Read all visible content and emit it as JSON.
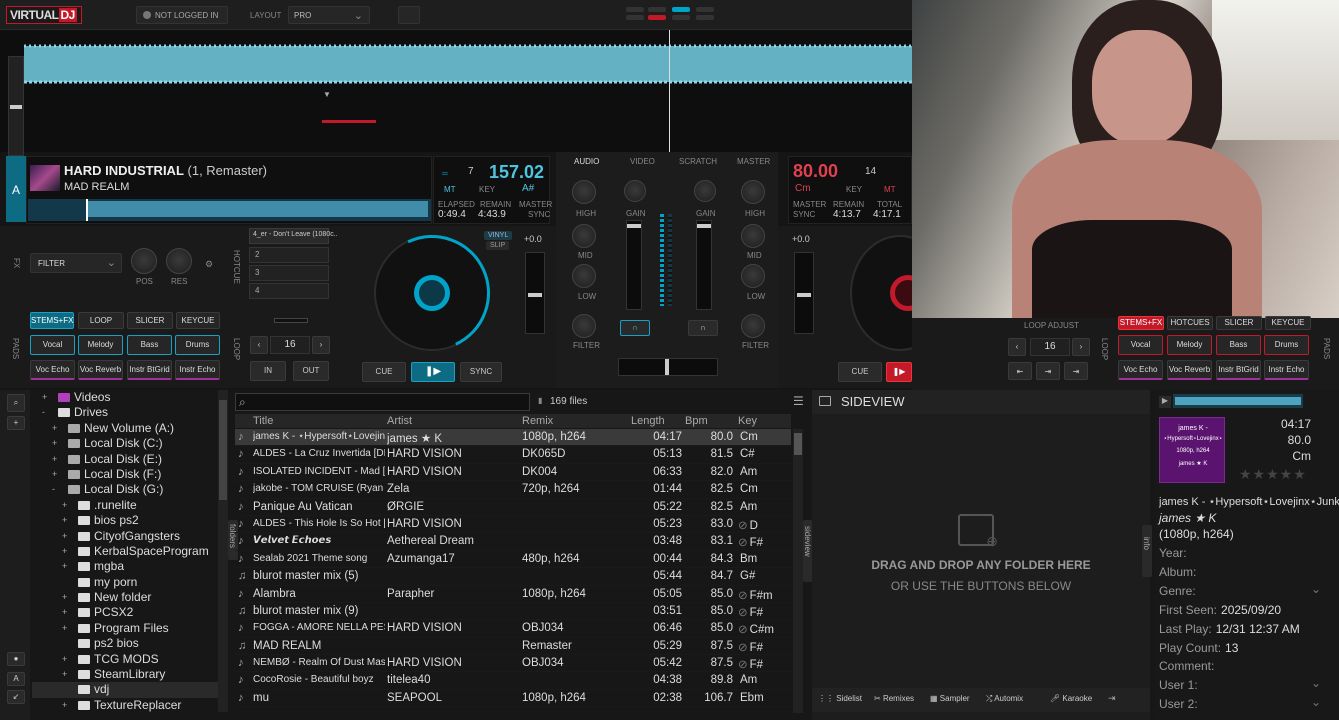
{
  "app": {
    "logo": "VIRTUAL",
    "logo_b": "DJ",
    "login": "NOT LOGGED IN",
    "layout_label": "LAYOUT",
    "layout_value": "PRO"
  },
  "deck_left": {
    "letter": "A",
    "title": "HARD INDUSTRIAL",
    "title_extra": "(1, Remaster)",
    "artist": "MAD REALM",
    "num": "7",
    "bpm": "157.02",
    "mt": "MT",
    "key_label": "KEY",
    "key": "A#",
    "elapsed_label": "ELAPSED",
    "elapsed": "0:49.4",
    "remain_label": "REMAIN",
    "remain": "4:43.9",
    "master": "MASTER",
    "sync": "SYNC",
    "fx_label": "FX",
    "filter": "FILTER",
    "pos": "POS",
    "res": "RES",
    "hotcue_label": "HOTCUE",
    "hotcues": [
      "4_er - Don't Leave (1080c..",
      "2",
      "3",
      "4"
    ],
    "vinyl": "VINYL",
    "slip": "SLIP",
    "pitch": "+0.0",
    "loop_value": "16",
    "in": "IN",
    "out": "OUT",
    "cue": "CUE",
    "sync_btn": "SYNC",
    "pad_tabs": [
      "STEMS+FX",
      "LOOP",
      "SLICER",
      "KEYCUE"
    ],
    "pads": [
      "Vocal",
      "Melody",
      "Bass",
      "Drums",
      "Voc Echo",
      "Voc Reverb",
      "Instr BtGrid",
      "Instr Echo"
    ],
    "pads_label": "PADS",
    "loop_label": "LOOP"
  },
  "mixer": {
    "tabs": [
      "AUDIO",
      "VIDEO",
      "SCRATCH",
      "MASTER"
    ],
    "high": "HIGH",
    "mid": "MID",
    "low": "LOW",
    "gain": "GAIN",
    "filter": "FILTER"
  },
  "deck_right": {
    "bpm": "80.00",
    "num": "14",
    "cm": "Cm",
    "mt": "MT",
    "key_label": "KEY",
    "master": "MASTER",
    "sync": "SYNC",
    "remain_label": "REMAIN",
    "remain": "4:13.7",
    "total_label": "TOTAL",
    "total": "4:17.1",
    "pitch": "+0.0",
    "loop_adjust": "LOOP ADJUST",
    "loop_value": "16",
    "cue": "CUE",
    "sync_btn": "SYNC",
    "pad_tabs": [
      "STEMS+FX",
      "HOTCUES",
      "SLICER",
      "KEYCUE"
    ],
    "pads": [
      "Vocal",
      "Melody",
      "Bass",
      "Drums",
      "Voc Echo",
      "Voc Reverb",
      "Instr BtGrid",
      "Instr Echo"
    ],
    "pads_label": "PADS",
    "loop_label": "LOOP"
  },
  "browser": {
    "file_count": "169 files",
    "folders_tab": "folders",
    "sideview_tab": "sideview",
    "info_tab": "info",
    "tree": [
      {
        "label": "Videos",
        "pm": "+",
        "indent": 0,
        "type": "video"
      },
      {
        "label": "Drives",
        "pm": "-",
        "indent": 0,
        "type": "drive"
      },
      {
        "label": "New Volume (A:)",
        "pm": "+",
        "indent": 1,
        "type": "disk"
      },
      {
        "label": "Local Disk (C:)",
        "pm": "+",
        "indent": 1,
        "type": "disk"
      },
      {
        "label": "Local Disk (E:)",
        "pm": "+",
        "indent": 1,
        "type": "disk"
      },
      {
        "label": "Local Disk (F:)",
        "pm": "+",
        "indent": 1,
        "type": "disk"
      },
      {
        "label": "Local Disk (G:)",
        "pm": "-",
        "indent": 1,
        "type": "disk"
      },
      {
        "label": ".runelite",
        "pm": "+",
        "indent": 2,
        "type": "folder"
      },
      {
        "label": "bios ps2",
        "pm": "+",
        "indent": 2,
        "type": "folder"
      },
      {
        "label": "CityofGangsters",
        "pm": "+",
        "indent": 2,
        "type": "folder"
      },
      {
        "label": "KerbalSpaceProgram",
        "pm": "+",
        "indent": 2,
        "type": "folder"
      },
      {
        "label": "mgba",
        "pm": "+",
        "indent": 2,
        "type": "folder"
      },
      {
        "label": "my porn",
        "pm": "",
        "indent": 2,
        "type": "folder"
      },
      {
        "label": "New folder",
        "pm": "+",
        "indent": 2,
        "type": "folder"
      },
      {
        "label": "PCSX2",
        "pm": "+",
        "indent": 2,
        "type": "folder"
      },
      {
        "label": "Program Files",
        "pm": "+",
        "indent": 2,
        "type": "folder"
      },
      {
        "label": "ps2 bios",
        "pm": "",
        "indent": 2,
        "type": "folder"
      },
      {
        "label": "TCG MODS",
        "pm": "+",
        "indent": 2,
        "type": "folder"
      },
      {
        "label": "SteamLibrary",
        "pm": "+",
        "indent": 2,
        "type": "folder"
      },
      {
        "label": "vdj",
        "pm": "",
        "indent": 2,
        "type": "folder"
      },
      {
        "label": "TextureReplacer",
        "pm": "+",
        "indent": 2,
        "type": "folder"
      }
    ],
    "columns": [
      "Title",
      "Artist",
      "Remix",
      "Length",
      "Bpm",
      "Key"
    ],
    "rows": [
      [
        "james K - ⋆Hypersoft⋆Lovejinx⋆Junkd",
        "james ★ K",
        "1080p, h264",
        "04:17",
        "80.0",
        "Cm",
        ""
      ],
      [
        "ALDES - La Cruz Invertida [DK065D]",
        "HARD VISION",
        "DK065D",
        "05:13",
        "81.5",
        "C#",
        ""
      ],
      [
        "ISOLATED INCIDENT - Mad [DK004]",
        "HARD VISION",
        "DK004",
        "06:33",
        "82.0",
        "Am",
        ""
      ],
      [
        "jakobe - TOM CRUISE (Ryan Celsius)",
        "Zela",
        "720p, h264",
        "01:44",
        "82.5",
        "Cm",
        ""
      ],
      [
        "Panique Au Vatican",
        "ØRGIE",
        "",
        "05:22",
        "82.5",
        "Am",
        ""
      ],
      [
        "ALDES - This Hole Is So Hot [DK065]",
        "HARD VISION",
        "",
        "05:23",
        "83.0",
        "D",
        "⊘"
      ],
      [
        "𝙑𝙚𝙡𝙫𝙚𝙩 𝙀𝙘𝙝𝙤𝙚𝙨",
        "Aethereal Dream",
        "",
        "03:48",
        "83.1",
        "F#",
        "⊘"
      ],
      [
        "Sealab 2021 Theme song",
        "Azumanga17",
        "480p, h264",
        "00:44",
        "84.3",
        "Bm",
        ""
      ],
      [
        "blurot master mix (5)",
        "",
        "",
        "05:44",
        "84.7",
        "G#",
        ""
      ],
      [
        "Alambra",
        "Parapher",
        "1080p, h264",
        "05:05",
        "85.0",
        "F#m",
        "⊘"
      ],
      [
        "blurot master mix (9)",
        "",
        "",
        "03:51",
        "85.0",
        "F#",
        "⊘"
      ],
      [
        "FOGGA - AMORE NELLA PESTE [OBJ034]",
        "HARD VISION",
        "OBJ034",
        "06:46",
        "85.0",
        "C#m",
        "⊘"
      ],
      [
        "MAD REALM",
        "",
        "Remaster",
        "05:29",
        "87.5",
        "F#",
        "⊘"
      ],
      [
        "NEMBØ - Realm Of Dust Master [OBJ034]",
        "HARD VISION",
        "OBJ034",
        "05:42",
        "87.5",
        "F#",
        "⊘"
      ],
      [
        "CocoRosie - Beautiful boyz",
        "titelea40",
        "",
        "04:38",
        "89.8",
        "Am",
        ""
      ],
      [
        "mu",
        "SEAPOOL",
        "1080p, h264",
        "02:38",
        "106.7",
        "Ebm",
        ""
      ]
    ]
  },
  "sideview": {
    "title": "SIDEVIEW",
    "drop_1": "DRAG AND DROP ANY FOLDER HERE",
    "drop_2": "OR USE THE BUTTONS BELOW",
    "bottom": [
      "Sidelist",
      "Remixes",
      "Sampler",
      "Automix",
      "Karaoke"
    ]
  },
  "info": {
    "length": "04:17",
    "bpm": "80.0",
    "key": "Cm",
    "art_1": "james K -",
    "art_2": "⋆Hypersoft⋆Lovejinx⋆",
    "art_3": "1080p, h264",
    "art_4": "james ★ K",
    "title": "james K - ⋆Hypersoft⋆Lovejinx⋆Junkdrea",
    "artist": "james ★ K",
    "remix": "(1080p, h264)",
    "fields": [
      {
        "label": "Year:",
        "value": ""
      },
      {
        "label": "Album:",
        "value": ""
      },
      {
        "label": "Genre:",
        "value": ""
      },
      {
        "label": "First Seen:",
        "value": "2025/09/20"
      },
      {
        "label": "Last Play:",
        "value": "12/31 12:37 AM"
      },
      {
        "label": "Play Count:",
        "value": "13"
      },
      {
        "label": "Comment:",
        "value": ""
      },
      {
        "label": "User 1:",
        "value": ""
      },
      {
        "label": "User 2:",
        "value": ""
      }
    ]
  },
  "colors": {
    "accent": "#00a4c8",
    "red": "#c21a2a",
    "wave": "#6fc3d8"
  }
}
